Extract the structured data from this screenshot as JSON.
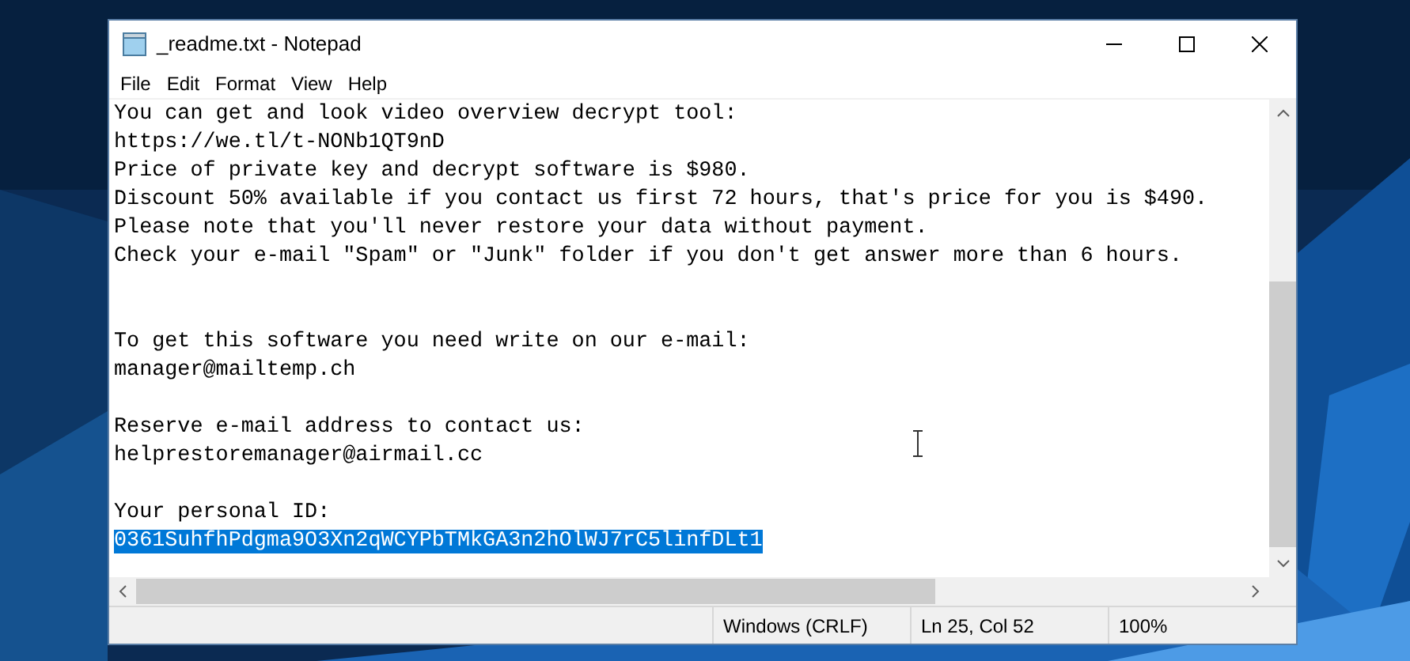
{
  "window": {
    "title": "_readme.txt - Notepad"
  },
  "menu": [
    "File",
    "Edit",
    "Format",
    "View",
    "Help"
  ],
  "lines": [
    {
      "kind": "text",
      "text": "You can get and look video overview decrypt tool:",
      "selected": false
    },
    {
      "kind": "text",
      "text": "https://we.tl/t-NONb1QT9nD",
      "selected": false
    },
    {
      "kind": "text",
      "text": "Price of private key and decrypt software is $980.",
      "selected": false
    },
    {
      "kind": "text",
      "text": "Discount 50% available if you contact us first 72 hours, that's price for you is $490.",
      "selected": false
    },
    {
      "kind": "text",
      "text": "Please note that you'll never restore your data without payment.",
      "selected": false
    },
    {
      "kind": "text",
      "text": "Check your e-mail \"Spam\" or \"Junk\" folder if you don't get answer more than 6 hours.",
      "selected": false
    },
    {
      "kind": "blank",
      "selected": false
    },
    {
      "kind": "blank",
      "selected": false
    },
    {
      "kind": "text",
      "text": "To get this software you need write on our e-mail:",
      "selected": false
    },
    {
      "kind": "text",
      "text": "manager@mailtemp.ch",
      "selected": false
    },
    {
      "kind": "blank",
      "selected": false
    },
    {
      "kind": "text",
      "text": "Reserve e-mail address to contact us:",
      "selected": false
    },
    {
      "kind": "text",
      "text": "helprestoremanager@airmail.cc",
      "selected": false
    },
    {
      "kind": "blank",
      "selected": false
    },
    {
      "kind": "text",
      "text": "Your personal ID:",
      "selected": false
    },
    {
      "kind": "text",
      "text": "0361SuhfhPdgma9O3Xn2qWCYPbTMkGA3n2hOlWJ7rC5linfDLt1",
      "selected": true
    }
  ],
  "status_bar": [
    "Windows (CRLF)",
    "Ln 25, Col 52",
    "100%"
  ]
}
